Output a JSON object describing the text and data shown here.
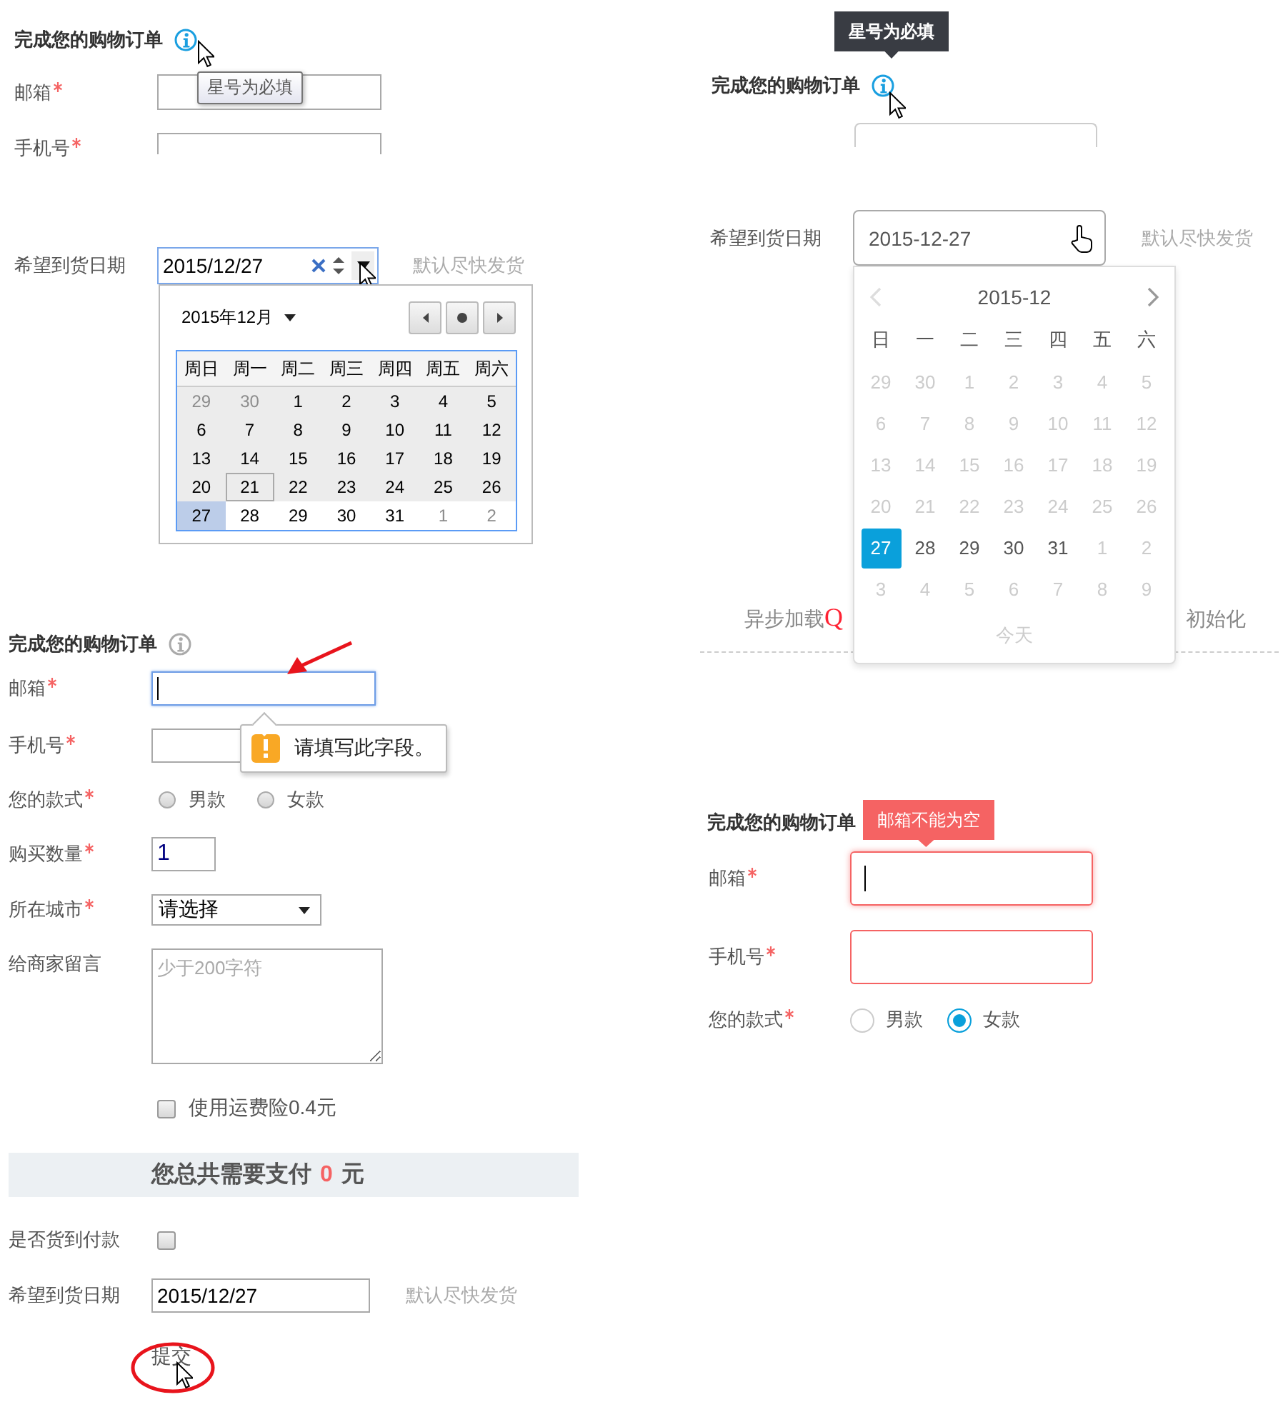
{
  "native_demo": {
    "title": "完成您的购物订单",
    "tooltip": "星号为必填",
    "fields": [
      {
        "label": "邮箱",
        "required": true
      },
      {
        "label": "手机号",
        "required": true
      }
    ],
    "date": {
      "label": "希望到货日期",
      "value": "2015/12/27",
      "hint": "默认尽快发货"
    },
    "calendar": {
      "month": "2015年12月",
      "weekdays": [
        "周日",
        "周一",
        "周二",
        "周三",
        "周四",
        "周五",
        "周六"
      ],
      "weeks": [
        [
          {
            "day": "29",
            "other_month": true,
            "disabled": true,
            "selected": false,
            "today": false
          },
          {
            "day": "30",
            "other_month": true,
            "disabled": true,
            "selected": false,
            "today": false
          },
          {
            "day": "1",
            "other_month": false,
            "disabled": true,
            "selected": false,
            "today": false
          },
          {
            "day": "2",
            "other_month": false,
            "disabled": true,
            "selected": false,
            "today": false
          },
          {
            "day": "3",
            "other_month": false,
            "disabled": true,
            "selected": false,
            "today": false
          },
          {
            "day": "4",
            "other_month": false,
            "disabled": true,
            "selected": false,
            "today": false
          },
          {
            "day": "5",
            "other_month": false,
            "disabled": true,
            "selected": false,
            "today": false
          }
        ],
        [
          {
            "day": "6",
            "other_month": false,
            "disabled": true,
            "selected": false,
            "today": false
          },
          {
            "day": "7",
            "other_month": false,
            "disabled": true,
            "selected": false,
            "today": false
          },
          {
            "day": "8",
            "other_month": false,
            "disabled": true,
            "selected": false,
            "today": false
          },
          {
            "day": "9",
            "other_month": false,
            "disabled": true,
            "selected": false,
            "today": false
          },
          {
            "day": "10",
            "other_month": false,
            "disabled": true,
            "selected": false,
            "today": false
          },
          {
            "day": "11",
            "other_month": false,
            "disabled": true,
            "selected": false,
            "today": false
          },
          {
            "day": "12",
            "other_month": false,
            "disabled": true,
            "selected": false,
            "today": false
          }
        ],
        [
          {
            "day": "13",
            "other_month": false,
            "disabled": true,
            "selected": false,
            "today": false
          },
          {
            "day": "14",
            "other_month": false,
            "disabled": true,
            "selected": false,
            "today": false
          },
          {
            "day": "15",
            "other_month": false,
            "disabled": true,
            "selected": false,
            "today": false
          },
          {
            "day": "16",
            "other_month": false,
            "disabled": true,
            "selected": false,
            "today": false
          },
          {
            "day": "17",
            "other_month": false,
            "disabled": true,
            "selected": false,
            "today": false
          },
          {
            "day": "18",
            "other_month": false,
            "disabled": true,
            "selected": false,
            "today": false
          },
          {
            "day": "19",
            "other_month": false,
            "disabled": true,
            "selected": false,
            "today": false
          }
        ],
        [
          {
            "day": "20",
            "other_month": false,
            "disabled": true,
            "selected": false,
            "today": false
          },
          {
            "day": "21",
            "other_month": false,
            "disabled": true,
            "selected": false,
            "today": true
          },
          {
            "day": "22",
            "other_month": false,
            "disabled": true,
            "selected": false,
            "today": false
          },
          {
            "day": "23",
            "other_month": false,
            "disabled": true,
            "selected": false,
            "today": false
          },
          {
            "day": "24",
            "other_month": false,
            "disabled": true,
            "selected": false,
            "today": false
          },
          {
            "day": "25",
            "other_month": false,
            "disabled": true,
            "selected": false,
            "today": false
          },
          {
            "day": "26",
            "other_month": false,
            "disabled": true,
            "selected": false,
            "today": false
          }
        ],
        [
          {
            "day": "27",
            "other_month": false,
            "disabled": false,
            "selected": true,
            "today": false
          },
          {
            "day": "28",
            "other_month": false,
            "disabled": false,
            "selected": false,
            "today": false
          },
          {
            "day": "29",
            "other_month": false,
            "disabled": false,
            "selected": false,
            "today": false
          },
          {
            "day": "30",
            "other_month": false,
            "disabled": false,
            "selected": false,
            "today": false
          },
          {
            "day": "31",
            "other_month": false,
            "disabled": false,
            "selected": false,
            "today": false
          },
          {
            "day": "1",
            "other_month": true,
            "disabled": false,
            "selected": false,
            "today": false
          },
          {
            "day": "2",
            "other_month": true,
            "disabled": false,
            "selected": false,
            "today": false
          }
        ]
      ]
    }
  },
  "styled_demo": {
    "tooltip": "星号为必填",
    "title": "完成您的购物订单",
    "date": {
      "label": "希望到货日期",
      "value": "2015-12-27",
      "hint": "默认尽快发货"
    },
    "calendar": {
      "month": "2015-12",
      "weekdays": [
        "日",
        "一",
        "二",
        "三",
        "四",
        "五",
        "六"
      ],
      "weeks": [
        [
          {
            "day": "29",
            "muted": true,
            "selected": false
          },
          {
            "day": "30",
            "muted": true,
            "selected": false
          },
          {
            "day": "1",
            "muted": true,
            "selected": false
          },
          {
            "day": "2",
            "muted": true,
            "selected": false
          },
          {
            "day": "3",
            "muted": true,
            "selected": false
          },
          {
            "day": "4",
            "muted": true,
            "selected": false
          },
          {
            "day": "5",
            "muted": true,
            "selected": false
          }
        ],
        [
          {
            "day": "6",
            "muted": true,
            "selected": false
          },
          {
            "day": "7",
            "muted": true,
            "selected": false
          },
          {
            "day": "8",
            "muted": true,
            "selected": false
          },
          {
            "day": "9",
            "muted": true,
            "selected": false
          },
          {
            "day": "10",
            "muted": true,
            "selected": false
          },
          {
            "day": "11",
            "muted": true,
            "selected": false
          },
          {
            "day": "12",
            "muted": true,
            "selected": false
          }
        ],
        [
          {
            "day": "13",
            "muted": true,
            "selected": false
          },
          {
            "day": "14",
            "muted": true,
            "selected": false
          },
          {
            "day": "15",
            "muted": true,
            "selected": false
          },
          {
            "day": "16",
            "muted": true,
            "selected": false
          },
          {
            "day": "17",
            "muted": true,
            "selected": false
          },
          {
            "day": "18",
            "muted": true,
            "selected": false
          },
          {
            "day": "19",
            "muted": true,
            "selected": false
          }
        ],
        [
          {
            "day": "20",
            "muted": true,
            "selected": false
          },
          {
            "day": "21",
            "muted": true,
            "selected": false
          },
          {
            "day": "22",
            "muted": true,
            "selected": false
          },
          {
            "day": "23",
            "muted": true,
            "selected": false
          },
          {
            "day": "24",
            "muted": true,
            "selected": false
          },
          {
            "day": "25",
            "muted": true,
            "selected": false
          },
          {
            "day": "26",
            "muted": true,
            "selected": false
          }
        ],
        [
          {
            "day": "27",
            "muted": false,
            "selected": true
          },
          {
            "day": "28",
            "muted": false,
            "selected": false
          },
          {
            "day": "29",
            "muted": false,
            "selected": false
          },
          {
            "day": "30",
            "muted": false,
            "selected": false
          },
          {
            "day": "31",
            "muted": false,
            "selected": false
          },
          {
            "day": "1",
            "muted": true,
            "selected": false
          },
          {
            "day": "2",
            "muted": true,
            "selected": false
          }
        ],
        [
          {
            "day": "3",
            "muted": true,
            "selected": false
          },
          {
            "day": "4",
            "muted": true,
            "selected": false
          },
          {
            "day": "5",
            "muted": true,
            "selected": false
          },
          {
            "day": "6",
            "muted": true,
            "selected": false
          },
          {
            "day": "7",
            "muted": true,
            "selected": false
          },
          {
            "day": "8",
            "muted": true,
            "selected": false
          },
          {
            "day": "9",
            "muted": true,
            "selected": false
          }
        ]
      ],
      "today_button": "今天"
    },
    "note": {
      "prefix": "异步加载",
      "highlight": "Q",
      "suffix": "初始化"
    }
  },
  "validation_demo": {
    "title": "完成您的购物订单",
    "message": "请填写此字段。",
    "rows": [
      {
        "kind": "text",
        "label": "邮箱",
        "required": true,
        "focused": true
      },
      {
        "kind": "text",
        "label": "手机号",
        "required": true,
        "focused": false
      },
      {
        "kind": "radio",
        "label": "您的款式",
        "required": true,
        "options": [
          {
            "label": "男款",
            "selected": false
          },
          {
            "label": "女款",
            "selected": false
          }
        ]
      },
      {
        "kind": "number",
        "label": "购买数量",
        "required": true,
        "value": "1"
      },
      {
        "kind": "select",
        "label": "所在城市",
        "required": true,
        "value": "请选择"
      },
      {
        "kind": "textarea",
        "label": "给商家留言",
        "required": false,
        "placeholder": "少于200字符"
      },
      {
        "kind": "checkbox",
        "text": "使用运费险0.4元",
        "checked": false
      },
      {
        "kind": "total",
        "prefix": "您总共需要支付",
        "amount": "0",
        "suffix": "元"
      },
      {
        "kind": "toggle",
        "label": "是否货到付款",
        "checked": false
      },
      {
        "kind": "date",
        "label": "希望到货日期",
        "value": "2015/12/27",
        "hint": "默认尽快发货"
      },
      {
        "kind": "submit",
        "text": "提交"
      }
    ]
  },
  "error_demo": {
    "title": "完成您的购物订单",
    "tooltip": "邮箱不能为空",
    "rows": [
      {
        "kind": "text",
        "label": "邮箱",
        "required": true,
        "error": true,
        "focused": true
      },
      {
        "kind": "text",
        "label": "手机号",
        "required": true,
        "error": true,
        "focused": false
      },
      {
        "kind": "radio",
        "label": "您的款式",
        "required": true,
        "options": [
          {
            "label": "男款",
            "selected": false
          },
          {
            "label": "女款",
            "selected": true
          }
        ]
      }
    ]
  }
}
